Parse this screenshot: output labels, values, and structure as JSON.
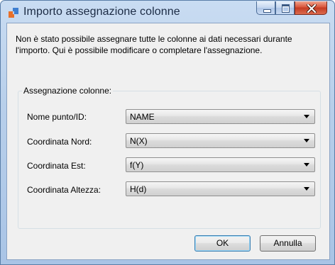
{
  "window": {
    "title": "Importo assegnazione colonne",
    "icons": {
      "app": "table-import-icon",
      "minimize": "minimize-icon",
      "maximize": "maximize-icon",
      "close": "close-icon"
    },
    "colors": {
      "title_gradient": "#b8cfea",
      "close_button": "#c43b22",
      "client_bg": "#f0f0f0"
    }
  },
  "message": "Non è stato possibile assegnare tutte le colonne ai dati necessari durante l'importo. Qui è possibile modificare o completare l'assegnazione.",
  "group": {
    "title": "Assegnazione colonne:",
    "rows": [
      {
        "label": "Nome punto/ID:",
        "value": "NAME"
      },
      {
        "label": "Coordinata  Nord:",
        "value": "N(X)"
      },
      {
        "label": "Coordinata  Est:",
        "value": "f(Y)"
      },
      {
        "label": "Coordinata Altezza:",
        "value": "H(d)"
      }
    ]
  },
  "buttons": {
    "ok": "OK",
    "cancel": "Annulla"
  }
}
